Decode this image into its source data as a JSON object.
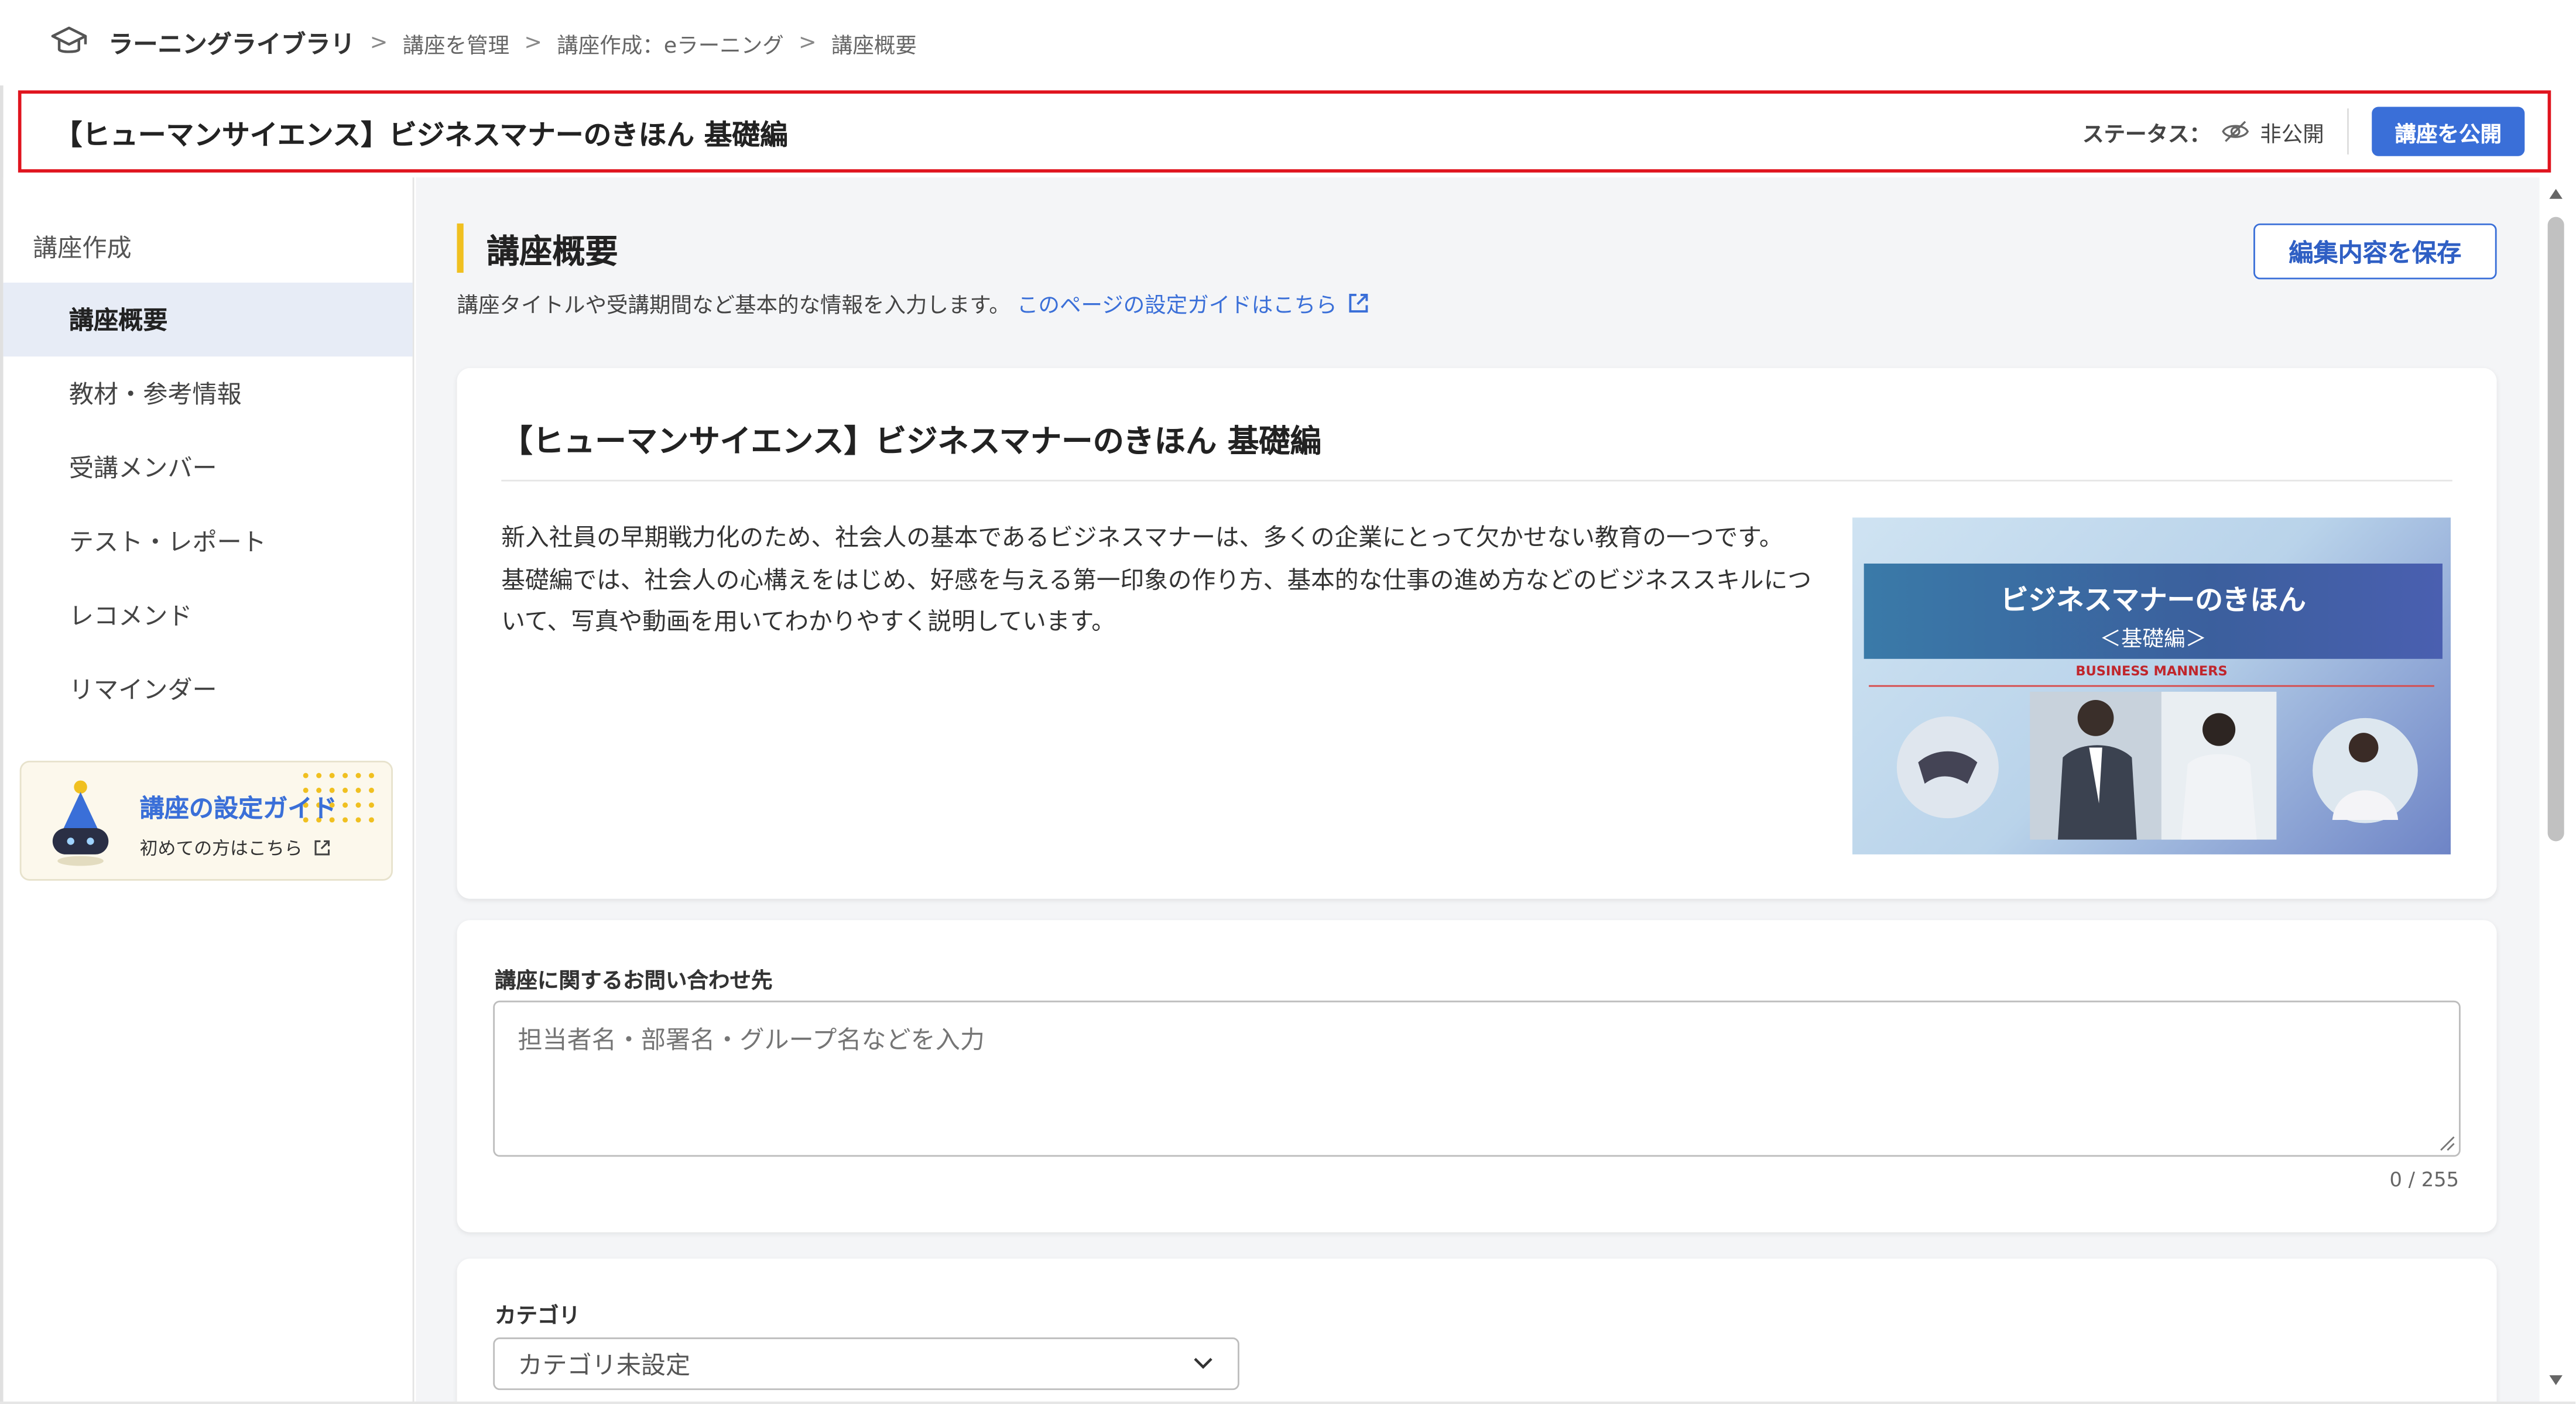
{
  "breadcrumb": {
    "app_name": "ラーニングライブラリ",
    "items": [
      "講座を管理",
      "講座作成：eラーニング",
      "講座概要"
    ],
    "separator": ">"
  },
  "titlebar": {
    "course_title": "【ヒューマンサイエンス】ビジネスマナーのきほん 基礎編",
    "status_label": "ステータス：",
    "status_value": "非公開",
    "publish_label": "講座を公開"
  },
  "sidebar": {
    "title": "講座作成",
    "items": [
      {
        "label": "講座概要",
        "active": true
      },
      {
        "label": "教材・参考情報",
        "active": false
      },
      {
        "label": "受講メンバー",
        "active": false
      },
      {
        "label": "テスト・レポート",
        "active": false
      },
      {
        "label": "レコメンド",
        "active": false
      },
      {
        "label": "リマインダー",
        "active": false
      }
    ],
    "guide": {
      "title": "講座の設定ガイド",
      "subtitle": "初めての方はこちら"
    }
  },
  "main": {
    "section_title": "講座概要",
    "section_desc": "講座タイトルや受講期間など基本的な情報を入力します。",
    "guide_link": "このページの設定ガイドはこちら",
    "save_label": "編集内容を保存",
    "overview": {
      "title": "【ヒューマンサイエンス】ビジネスマナーのきほん 基礎編",
      "desc_line1": "新入社員の早期戦力化のため、社会人の基本であるビジネスマナーは、多くの企業にとって欠かせない教育の一つです。",
      "desc_line2": "基礎編では、社会人の心構えをはじめ、好感を与える第一印象の作り方、基本的な仕事の進め方などのビジネススキルについて、写真や動画を用いてわかりやすく説明しています。",
      "thumbnail": {
        "title": "ビジネスマナーのきほん",
        "subtitle": "＜基礎編＞",
        "english": "BUSINESS MANNERS"
      }
    },
    "contact": {
      "label": "講座に関するお問い合わせ先",
      "placeholder": "担当者名・部署名・グループ名などを入力",
      "value": "",
      "counter": "0 / 255"
    },
    "category": {
      "label": "カテゴリ",
      "selected": "カテゴリ未設定"
    }
  },
  "colors": {
    "accent": "#3a6fd8",
    "highlight_border": "#e0141e",
    "section_bar": "#f0c020",
    "active_nav_bg": "#e7ecf6"
  },
  "icons": {
    "logo": "graduation-cap-icon",
    "status": "eye-off-icon",
    "external_link": "external-link-icon",
    "select": "chevron-down-icon"
  }
}
